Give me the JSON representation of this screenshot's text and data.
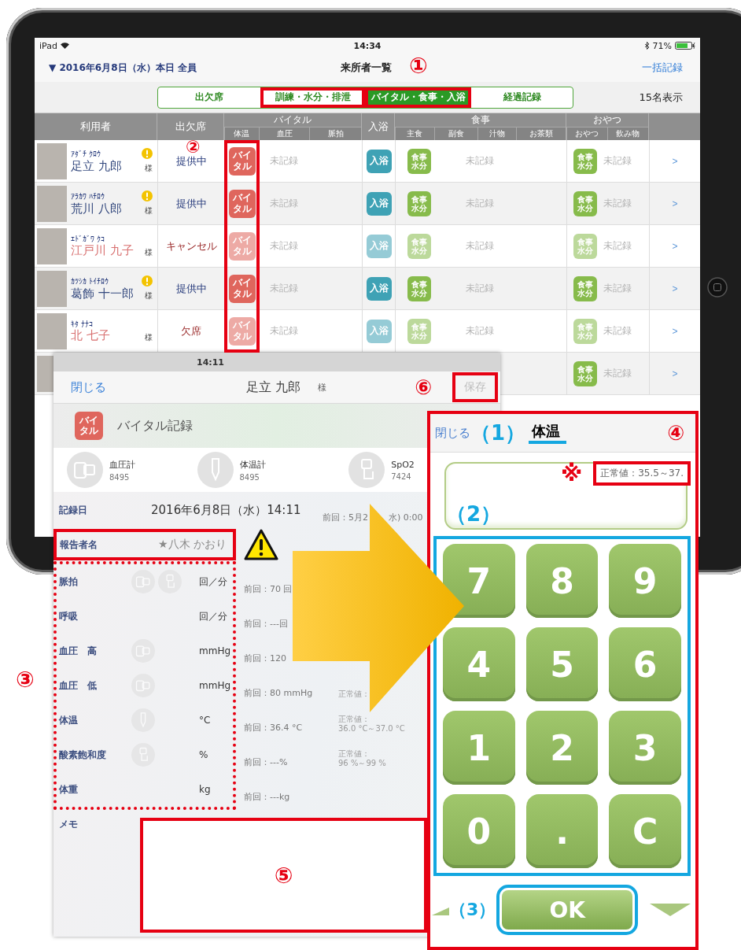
{
  "status_bar": {
    "device": "iPad",
    "time": "14:34",
    "battery": "71%"
  },
  "nav": {
    "date_filter": "▼ 2016年6月8日（水）本日 全員",
    "title": "来所者一覧",
    "action": "一括記録"
  },
  "tabs": [
    {
      "label": "出欠席",
      "selected": false
    },
    {
      "label": "訓練・水分・排泄",
      "selected": false
    },
    {
      "label": "バイタル・食事・入浴",
      "selected": true
    },
    {
      "label": "経過記録",
      "selected": false
    }
  ],
  "count": "15名表示",
  "table": {
    "columns": [
      {
        "label": "利用者"
      },
      {
        "label": "出欠席"
      },
      {
        "label": "バイタル",
        "sub": [
          "体温",
          "血圧",
          "脈拍"
        ]
      },
      {
        "label": "入浴"
      },
      {
        "label": "食事",
        "sub": [
          "主食",
          "副食",
          "汁物",
          "お茶類"
        ]
      },
      {
        "label": "おやつ",
        "sub": [
          "おやつ",
          "飲み物"
        ]
      }
    ],
    "rows": [
      {
        "kana": "ｱﾀﾞﾁ ｸﾛｳ",
        "name": "足立 九郎",
        "honorific": "様",
        "alert": true,
        "attendance": "提供中",
        "active": true,
        "vital": "バイタル",
        "vital_value": "未記録",
        "bath": "入浴",
        "meal": "食事水分",
        "meal_value": "未記録",
        "snack": "食事水分",
        "snack_value": "未記録",
        "more": ">"
      },
      {
        "kana": "ｱﾗｶﾜ ﾊﾁﾛｳ",
        "name": "荒川 八郎",
        "honorific": "様",
        "alert": true,
        "attendance": "提供中",
        "active": true,
        "vital": "バイタル",
        "vital_value": "未記録",
        "bath": "入浴",
        "meal": "食事水分",
        "meal_value": "未記録",
        "snack": "食事水分",
        "snack_value": "未記録",
        "more": ">"
      },
      {
        "kana": "ｴﾄﾞｶﾞﾜ ｸｺ",
        "name": "江戸川 九子",
        "honorific": "様",
        "alert": false,
        "attendance": "キャンセル",
        "active": false,
        "vital": "バイタル",
        "vital_value": "未記録",
        "bath": "入浴",
        "meal": "食事水分",
        "meal_value": "未記録",
        "snack": "食事水分",
        "snack_value": "未記録",
        "more": ">"
      },
      {
        "kana": "ｶﾂｼｶ ﾄｲﾁﾛｳ",
        "name": "葛飾 十一郎",
        "honorific": "様",
        "alert": true,
        "attendance": "提供中",
        "active": true,
        "vital": "バイタル",
        "vital_value": "未記録",
        "bath": "入浴",
        "meal": "食事水分",
        "meal_value": "未記録",
        "snack": "食事水分",
        "snack_value": "未記録",
        "more": ">"
      },
      {
        "kana": "ｷﾀ ﾅﾅｺ",
        "name": "北 七子",
        "honorific": "様",
        "alert": false,
        "attendance": "欠席",
        "active": false,
        "vital": "バイタル",
        "vital_value": "未記録",
        "bath": "入浴",
        "meal": "食事水分",
        "meal_value": "未記録",
        "snack": "食事水分",
        "snack_value": "未記録",
        "more": ">"
      },
      {
        "alert": false,
        "active": true,
        "snack": "食事水分",
        "snack_value": "未記録",
        "more": ">"
      }
    ]
  },
  "vital_popup": {
    "time": "14:11",
    "close": "閉じる",
    "name": "足立 九郎",
    "honorific": "様",
    "save": "保存",
    "title_icon": "バイタル",
    "title": "バイタル記録",
    "devices": [
      {
        "name": "血圧計",
        "code": "8495"
      },
      {
        "name": "体温計",
        "code": "8495"
      },
      {
        "name": "SpO2",
        "code": "7424"
      }
    ],
    "date_label": "記録日",
    "date": "2016年6月8日（水）14:11",
    "previous_date": [
      "前回：5月2",
      "水) 0:00"
    ],
    "reporter_label": "報告者名",
    "reporter": "★八木 かおり",
    "vitals": [
      {
        "label": "脈拍",
        "unit": "回／分",
        "previous": "前回：70 回"
      },
      {
        "label": "呼吸",
        "unit": "回／分",
        "previous": "前回：---回"
      },
      {
        "label": "血圧　高",
        "unit": "mmHg",
        "previous": "前回：120"
      },
      {
        "label": "血圧　低",
        "unit": "mmHg",
        "previous": "前回：80 mmHg",
        "normal": [
          "正常値："
        ]
      },
      {
        "label": "体温",
        "unit": "°C",
        "previous": "前回：36.4 °C",
        "normal": [
          "正常値：",
          "36.0 °C～37.0 °C"
        ]
      },
      {
        "label": "酸素飽和度",
        "unit": "%",
        "previous": "前回：---%",
        "normal": [
          "正常値：",
          "96 %～99 %"
        ]
      },
      {
        "label": "体重",
        "unit": "kg",
        "previous": "前回：---kg"
      }
    ],
    "memo_label": "メモ"
  },
  "keypad": {
    "close": "閉じる",
    "field": "体温",
    "normal": "正常値：35.5～37.",
    "keys": [
      "7",
      "8",
      "9",
      "4",
      "5",
      "6",
      "1",
      "2",
      "3",
      "0",
      ".",
      "C"
    ],
    "ok": "OK"
  },
  "annotations": {
    "top_tabs": "①",
    "vital_column": "②",
    "vital_items": "③",
    "keypad_panel": "④",
    "memo": "⑤",
    "save": "⑥",
    "keypad_title": "（1）",
    "keypad_display": "（2）",
    "keypad_ok": "（3）",
    "normal_value": "※"
  }
}
